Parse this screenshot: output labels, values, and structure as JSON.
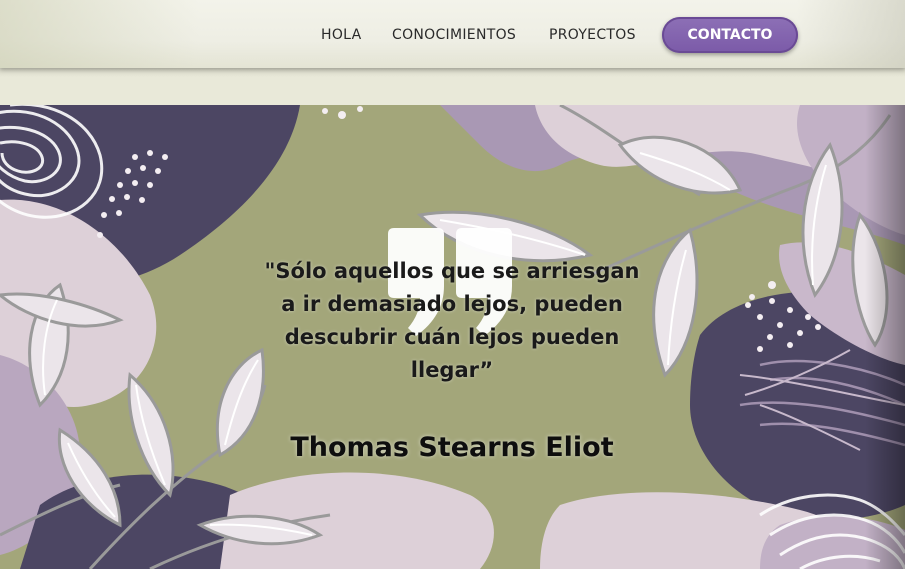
{
  "nav": {
    "items": [
      "HOLA",
      "CONOCIMIENTOS",
      "PROYECTOS"
    ],
    "cta": "CONTACTO"
  },
  "hero": {
    "quote": "\"Sólo aquellos que se arriesgan a ir demasiado lejos, pueden descubrir cuán lejos pueden llegar”",
    "author": "Thomas Stearns Eliot",
    "quote_icon": "quotation-mark-icon"
  },
  "colors": {
    "accent": "#7b5aa8",
    "olive": "#a3a67a",
    "plum": "#4c4663",
    "lilac": "#ddd0d8",
    "mauve": "#a998b4"
  }
}
